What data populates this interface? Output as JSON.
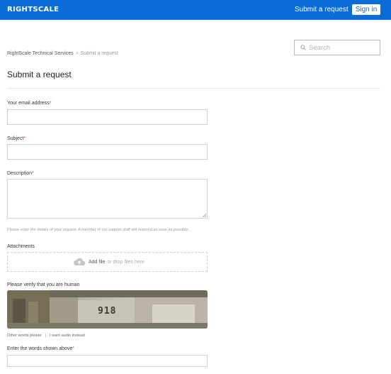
{
  "header": {
    "logo_text": "RIGHTSCALE",
    "nav_link": "Submit a request",
    "signin_label": "Sign in"
  },
  "search": {
    "placeholder": "Search",
    "icon": "search-icon"
  },
  "breadcrumb": {
    "home": "RightScale Technical Services",
    "separator": ">",
    "current": "Submit a request"
  },
  "page_title": "Submit a request",
  "form": {
    "email": {
      "label": "Your email address",
      "required_mark": "*",
      "value": ""
    },
    "subject": {
      "label": "Subject",
      "required_mark": "*",
      "value": ""
    },
    "description": {
      "label": "Description",
      "required_mark": "*",
      "value": "",
      "hint": "Please enter the details of your request. A member of our support staff will respond as soon as possible."
    },
    "attachments": {
      "label": "Attachments",
      "add_file": "Add file",
      "drop_text": "or drop files here",
      "icon": "cloud-upload-icon"
    },
    "captcha": {
      "label": "Please verify that you are human",
      "other_words": "Other words please",
      "link_separator": "|",
      "audio": "I want audio instead",
      "image_text": "918"
    },
    "captcha_answer": {
      "label": "Enter the words shown above",
      "required_mark": "*",
      "value": ""
    }
  },
  "colors": {
    "header_bg": "#0a6cd6",
    "required": "#e0443f"
  }
}
